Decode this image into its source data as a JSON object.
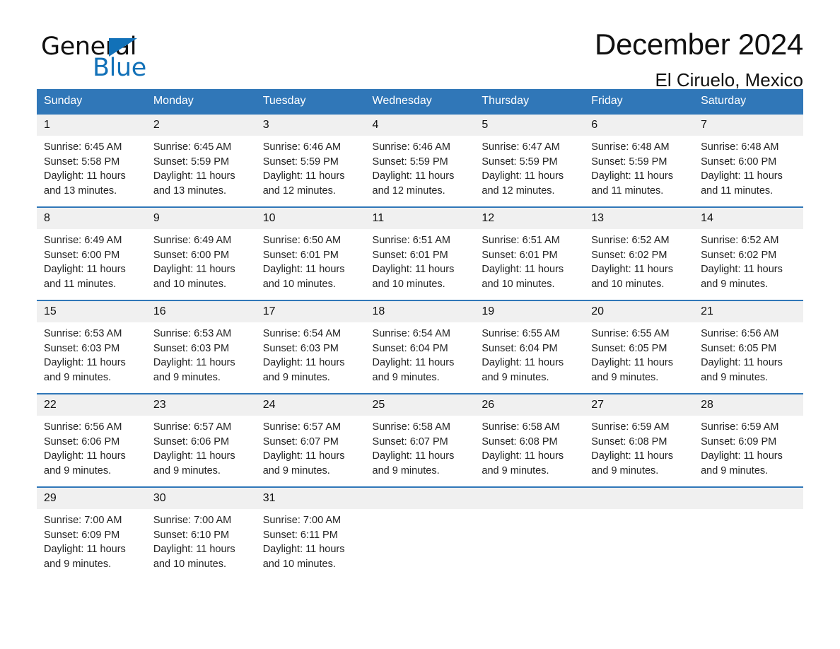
{
  "brand": {
    "word_one": "General",
    "word_two": "Blue",
    "accent_color": "#1271b8",
    "triangle_icon": "triangle-icon"
  },
  "header": {
    "title": "December 2024",
    "subtitle": "El Ciruelo, Mexico",
    "header_bg_color": "#3077b8",
    "daynum_bg_color": "#f0f0f0"
  },
  "weekdays": [
    "Sunday",
    "Monday",
    "Tuesday",
    "Wednesday",
    "Thursday",
    "Friday",
    "Saturday"
  ],
  "weeks": [
    [
      {
        "day": "1",
        "sunrise": "Sunrise: 6:45 AM",
        "sunset": "Sunset: 5:58 PM",
        "daylight": "Daylight: 11 hours\nand 13 minutes."
      },
      {
        "day": "2",
        "sunrise": "Sunrise: 6:45 AM",
        "sunset": "Sunset: 5:59 PM",
        "daylight": "Daylight: 11 hours\nand 13 minutes."
      },
      {
        "day": "3",
        "sunrise": "Sunrise: 6:46 AM",
        "sunset": "Sunset: 5:59 PM",
        "daylight": "Daylight: 11 hours\nand 12 minutes."
      },
      {
        "day": "4",
        "sunrise": "Sunrise: 6:46 AM",
        "sunset": "Sunset: 5:59 PM",
        "daylight": "Daylight: 11 hours\nand 12 minutes."
      },
      {
        "day": "5",
        "sunrise": "Sunrise: 6:47 AM",
        "sunset": "Sunset: 5:59 PM",
        "daylight": "Daylight: 11 hours\nand 12 minutes."
      },
      {
        "day": "6",
        "sunrise": "Sunrise: 6:48 AM",
        "sunset": "Sunset: 5:59 PM",
        "daylight": "Daylight: 11 hours\nand 11 minutes."
      },
      {
        "day": "7",
        "sunrise": "Sunrise: 6:48 AM",
        "sunset": "Sunset: 6:00 PM",
        "daylight": "Daylight: 11 hours\nand 11 minutes."
      }
    ],
    [
      {
        "day": "8",
        "sunrise": "Sunrise: 6:49 AM",
        "sunset": "Sunset: 6:00 PM",
        "daylight": "Daylight: 11 hours\nand 11 minutes."
      },
      {
        "day": "9",
        "sunrise": "Sunrise: 6:49 AM",
        "sunset": "Sunset: 6:00 PM",
        "daylight": "Daylight: 11 hours\nand 10 minutes."
      },
      {
        "day": "10",
        "sunrise": "Sunrise: 6:50 AM",
        "sunset": "Sunset: 6:01 PM",
        "daylight": "Daylight: 11 hours\nand 10 minutes."
      },
      {
        "day": "11",
        "sunrise": "Sunrise: 6:51 AM",
        "sunset": "Sunset: 6:01 PM",
        "daylight": "Daylight: 11 hours\nand 10 minutes."
      },
      {
        "day": "12",
        "sunrise": "Sunrise: 6:51 AM",
        "sunset": "Sunset: 6:01 PM",
        "daylight": "Daylight: 11 hours\nand 10 minutes."
      },
      {
        "day": "13",
        "sunrise": "Sunrise: 6:52 AM",
        "sunset": "Sunset: 6:02 PM",
        "daylight": "Daylight: 11 hours\nand 10 minutes."
      },
      {
        "day": "14",
        "sunrise": "Sunrise: 6:52 AM",
        "sunset": "Sunset: 6:02 PM",
        "daylight": "Daylight: 11 hours\nand 9 minutes."
      }
    ],
    [
      {
        "day": "15",
        "sunrise": "Sunrise: 6:53 AM",
        "sunset": "Sunset: 6:03 PM",
        "daylight": "Daylight: 11 hours\nand 9 minutes."
      },
      {
        "day": "16",
        "sunrise": "Sunrise: 6:53 AM",
        "sunset": "Sunset: 6:03 PM",
        "daylight": "Daylight: 11 hours\nand 9 minutes."
      },
      {
        "day": "17",
        "sunrise": "Sunrise: 6:54 AM",
        "sunset": "Sunset: 6:03 PM",
        "daylight": "Daylight: 11 hours\nand 9 minutes."
      },
      {
        "day": "18",
        "sunrise": "Sunrise: 6:54 AM",
        "sunset": "Sunset: 6:04 PM",
        "daylight": "Daylight: 11 hours\nand 9 minutes."
      },
      {
        "day": "19",
        "sunrise": "Sunrise: 6:55 AM",
        "sunset": "Sunset: 6:04 PM",
        "daylight": "Daylight: 11 hours\nand 9 minutes."
      },
      {
        "day": "20",
        "sunrise": "Sunrise: 6:55 AM",
        "sunset": "Sunset: 6:05 PM",
        "daylight": "Daylight: 11 hours\nand 9 minutes."
      },
      {
        "day": "21",
        "sunrise": "Sunrise: 6:56 AM",
        "sunset": "Sunset: 6:05 PM",
        "daylight": "Daylight: 11 hours\nand 9 minutes."
      }
    ],
    [
      {
        "day": "22",
        "sunrise": "Sunrise: 6:56 AM",
        "sunset": "Sunset: 6:06 PM",
        "daylight": "Daylight: 11 hours\nand 9 minutes."
      },
      {
        "day": "23",
        "sunrise": "Sunrise: 6:57 AM",
        "sunset": "Sunset: 6:06 PM",
        "daylight": "Daylight: 11 hours\nand 9 minutes."
      },
      {
        "day": "24",
        "sunrise": "Sunrise: 6:57 AM",
        "sunset": "Sunset: 6:07 PM",
        "daylight": "Daylight: 11 hours\nand 9 minutes."
      },
      {
        "day": "25",
        "sunrise": "Sunrise: 6:58 AM",
        "sunset": "Sunset: 6:07 PM",
        "daylight": "Daylight: 11 hours\nand 9 minutes."
      },
      {
        "day": "26",
        "sunrise": "Sunrise: 6:58 AM",
        "sunset": "Sunset: 6:08 PM",
        "daylight": "Daylight: 11 hours\nand 9 minutes."
      },
      {
        "day": "27",
        "sunrise": "Sunrise: 6:59 AM",
        "sunset": "Sunset: 6:08 PM",
        "daylight": "Daylight: 11 hours\nand 9 minutes."
      },
      {
        "day": "28",
        "sunrise": "Sunrise: 6:59 AM",
        "sunset": "Sunset: 6:09 PM",
        "daylight": "Daylight: 11 hours\nand 9 minutes."
      }
    ],
    [
      {
        "day": "29",
        "sunrise": "Sunrise: 7:00 AM",
        "sunset": "Sunset: 6:09 PM",
        "daylight": "Daylight: 11 hours\nand 9 minutes."
      },
      {
        "day": "30",
        "sunrise": "Sunrise: 7:00 AM",
        "sunset": "Sunset: 6:10 PM",
        "daylight": "Daylight: 11 hours\nand 10 minutes."
      },
      {
        "day": "31",
        "sunrise": "Sunrise: 7:00 AM",
        "sunset": "Sunset: 6:11 PM",
        "daylight": "Daylight: 11 hours\nand 10 minutes."
      },
      {
        "day": "",
        "sunrise": "",
        "sunset": "",
        "daylight": ""
      },
      {
        "day": "",
        "sunrise": "",
        "sunset": "",
        "daylight": ""
      },
      {
        "day": "",
        "sunrise": "",
        "sunset": "",
        "daylight": ""
      },
      {
        "day": "",
        "sunrise": "",
        "sunset": "",
        "daylight": ""
      }
    ]
  ]
}
